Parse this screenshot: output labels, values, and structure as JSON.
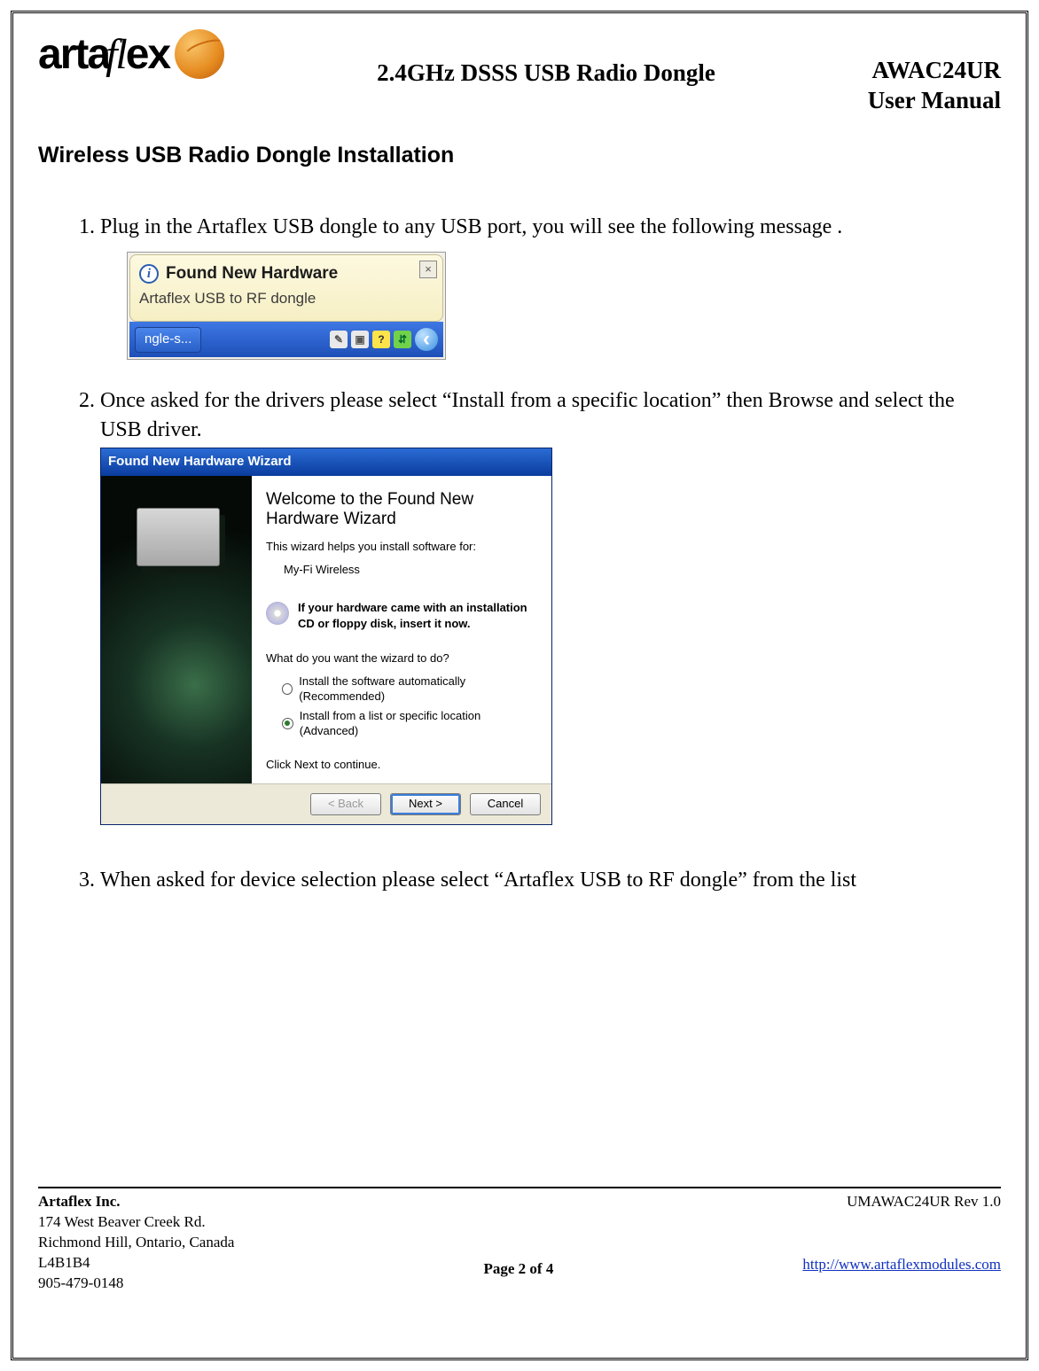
{
  "header": {
    "brand_a": "arta",
    "brand_fl": "fl",
    "brand_ex": "ex",
    "center": "2.4GHz DSSS USB Radio Dongle",
    "model": "AWAC24UR",
    "doc": "User Manual"
  },
  "section_title": "Wireless USB Radio Dongle Installation",
  "steps": {
    "s1": "Plug in the Artaflex USB dongle to any USB port, you will see the following message .",
    "s2": "Once asked for the drivers please select “Install from a specific location” then Browse and select the USB driver.",
    "s3": "When asked for device selection please select “Artaflex USB to RF dongle” from the list"
  },
  "balloon": {
    "title": "Found New Hardware",
    "sub": "Artaflex USB to RF dongle",
    "info_glyph": "i",
    "close_glyph": "×",
    "task_app": "ngle-s...",
    "tray_arrow": "‹"
  },
  "wizard": {
    "title": "Found New Hardware Wizard",
    "heading": "Welcome to the Found New Hardware Wizard",
    "helps": "This wizard helps you install software for:",
    "device": "My-Fi Wireless",
    "cd_note": "If your hardware came with an installation CD or floppy disk, insert it now.",
    "question": "What do you want the wizard to do?",
    "opt_auto": "Install the software automatically (Recommended)",
    "opt_list": "Install from a list or specific location (Advanced)",
    "click_next": "Click Next to continue.",
    "btn_back": "< Back",
    "btn_next": "Next >",
    "btn_cancel": "Cancel"
  },
  "footer": {
    "company": "Artaflex Inc.",
    "addr1": "174 West Beaver Creek Rd.",
    "addr2": "Richmond Hill, Ontario, Canada",
    "postal": "L4B1B4",
    "phone": "905-479-0148",
    "page": "Page 2 of 4",
    "rev": "UMAWAC24UR Rev 1.0",
    "url": "http://www.artaflexmodules.com"
  }
}
